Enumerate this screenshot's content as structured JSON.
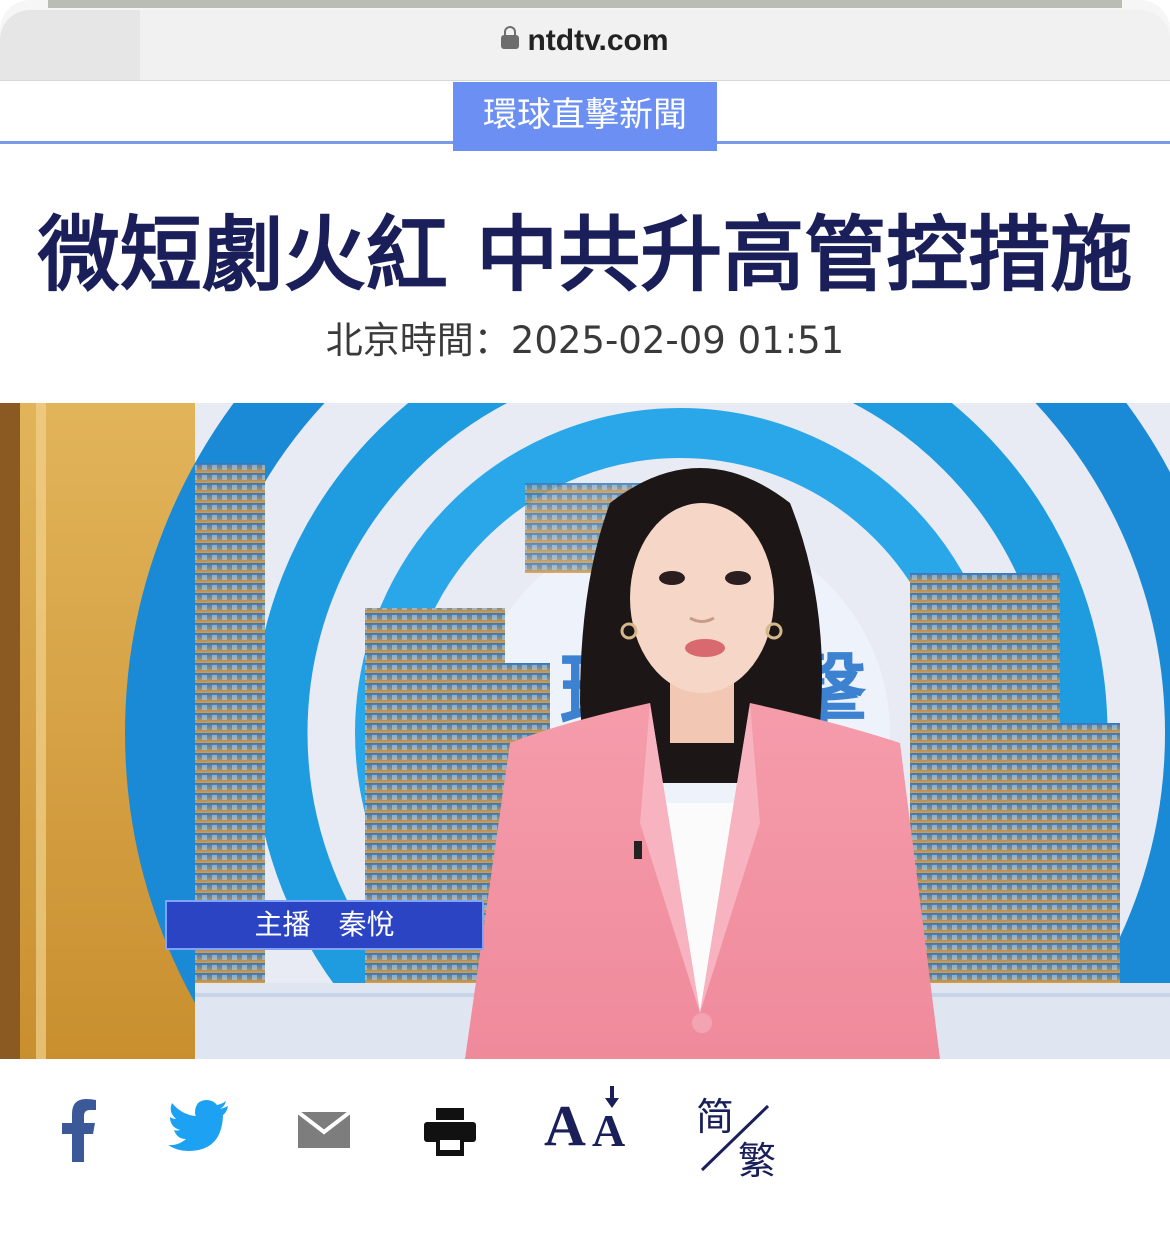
{
  "browser": {
    "url": "ntdtv.com"
  },
  "section": {
    "label": "環球直擊新聞"
  },
  "article": {
    "headline": "微短劇火紅 中共升高管控措施",
    "timestamp": "北京時間：2025-02-09 01:51"
  },
  "video": {
    "caption": "主播　秦悅"
  },
  "toolbar": {
    "items": [
      {
        "icon": "facebook-icon"
      },
      {
        "icon": "twitter-icon"
      },
      {
        "icon": "email-icon"
      },
      {
        "icon": "print-icon"
      },
      {
        "icon": "font-size-icon",
        "big_glyph": "A",
        "small_glyph": "A"
      },
      {
        "icon": "simplified-traditional-icon",
        "simp": "简",
        "trad": "繁"
      }
    ]
  },
  "colors": {
    "brand_navy": "#1a1f5a",
    "section_blue": "#6b8ff2",
    "facebook": "#3b5998",
    "twitter": "#1da1f2"
  }
}
